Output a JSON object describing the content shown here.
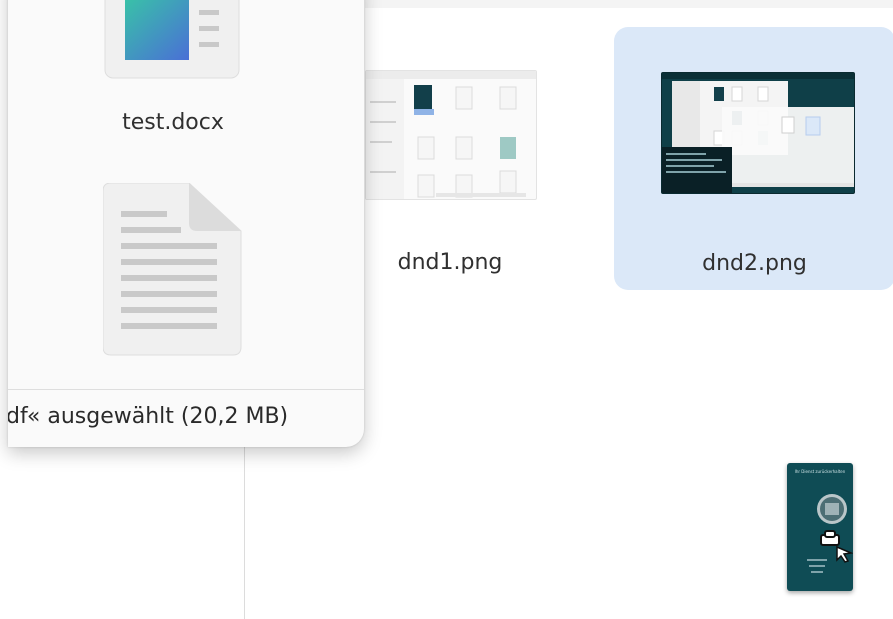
{
  "files": {
    "test_docx": {
      "name": "test.docx"
    },
    "dnd1": {
      "name": "dnd1.png"
    },
    "dnd2": {
      "name": "dnd2.png",
      "selected": true
    }
  },
  "status": {
    "text": "df« ausgewählt  (20,2 MB)"
  },
  "colors": {
    "selection": "#dbe8f8",
    "teal_screenshot": "#0f4c55",
    "doc_icon_bg": "#f0f0f0",
    "doc_icon_lines": "#c9c9c9"
  },
  "drag": {
    "title": "Ihr Dienst zurückerhalten",
    "cursor_icon": "drag-copy-cursor-icon"
  }
}
